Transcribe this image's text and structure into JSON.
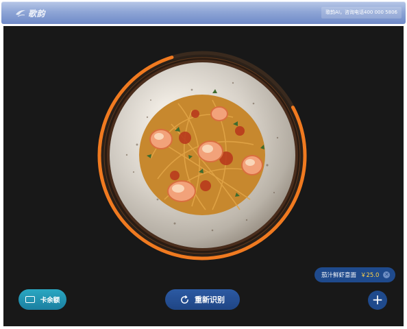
{
  "header": {
    "logo_text": "歌韵",
    "hotline": "歌韵AI，咨询电话400 000 5806"
  },
  "dish": {
    "name": "茄汁鲜虾意面",
    "price": "￥25.0",
    "recognition_progress": 0.78
  },
  "buttons": {
    "balance_label": "卡余额",
    "rescan_label": "重新识别",
    "add_label": "+"
  },
  "colors": {
    "ring_accent": "#f07a20",
    "button_blue": "#1f4a8c",
    "button_teal": "#2aa7c2",
    "price_yellow": "#ffd24a"
  },
  "icons": {
    "logo": "logo-icon",
    "card": "card-icon",
    "refresh": "refresh-icon",
    "close": "close-icon",
    "add": "plus-icon"
  }
}
